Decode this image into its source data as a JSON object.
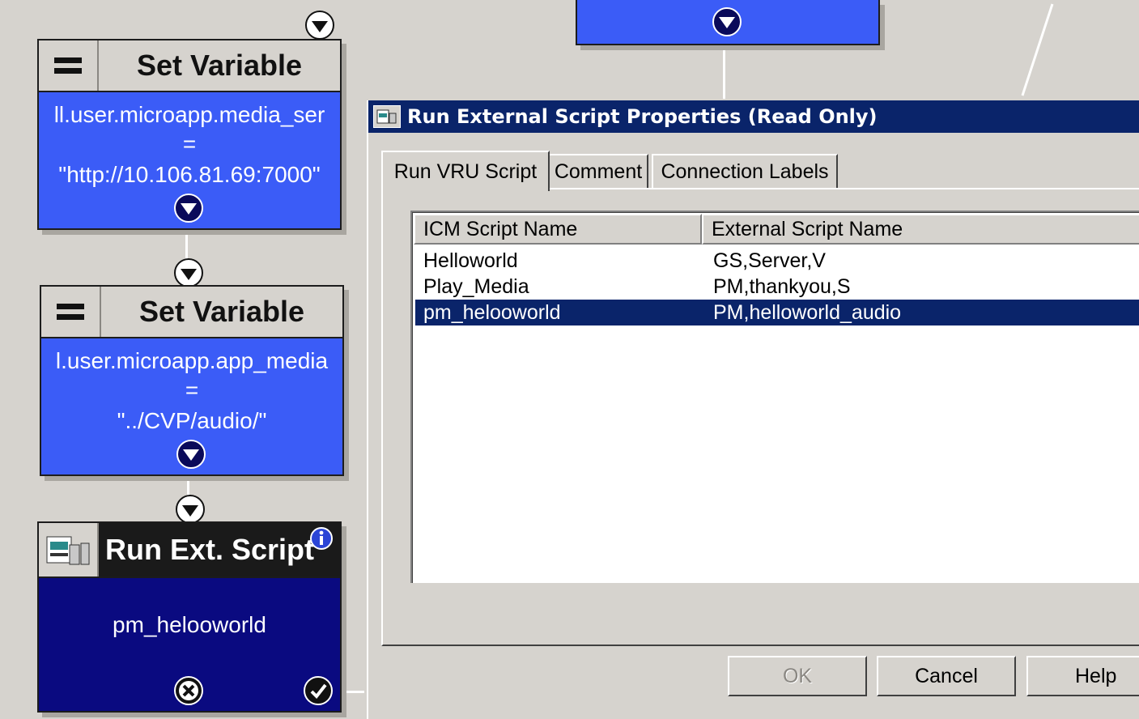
{
  "nodes": [
    {
      "title": "Set Variable",
      "line1": "ll.user.microapp.media_ser",
      "line2": "=",
      "line3": "\"http://10.106.81.69:7000\""
    },
    {
      "title": "Set Variable",
      "line1": "l.user.microapp.app_media",
      "line2": "=",
      "line3": "\"../CVP/audio/\""
    },
    {
      "title": "Run Ext. Script",
      "body": "pm_helooworld"
    }
  ],
  "dialog": {
    "title": "Run External Script Properties (Read Only)",
    "tabs": [
      "Run VRU Script",
      "Comment",
      "Connection Labels"
    ],
    "columns": [
      "ICM Script Name",
      "External Script Name"
    ],
    "rows": [
      {
        "icm": "Helloworld",
        "external": "GS,Server,V",
        "selected": false
      },
      {
        "icm": "Play_Media",
        "external": "PM,thankyou,S",
        "selected": false
      },
      {
        "icm": "pm_helooworld",
        "external": "PM,helloworld_audio",
        "selected": true
      }
    ],
    "buttons": {
      "ok": "OK",
      "cancel": "Cancel",
      "help": "Help"
    }
  },
  "colors": {
    "node_blue": "#3b5cf7",
    "node_dark": "#0a0a80",
    "titlebar": "#0a246a",
    "selection": "#0a246a",
    "canvas": "#d6d3ce"
  }
}
